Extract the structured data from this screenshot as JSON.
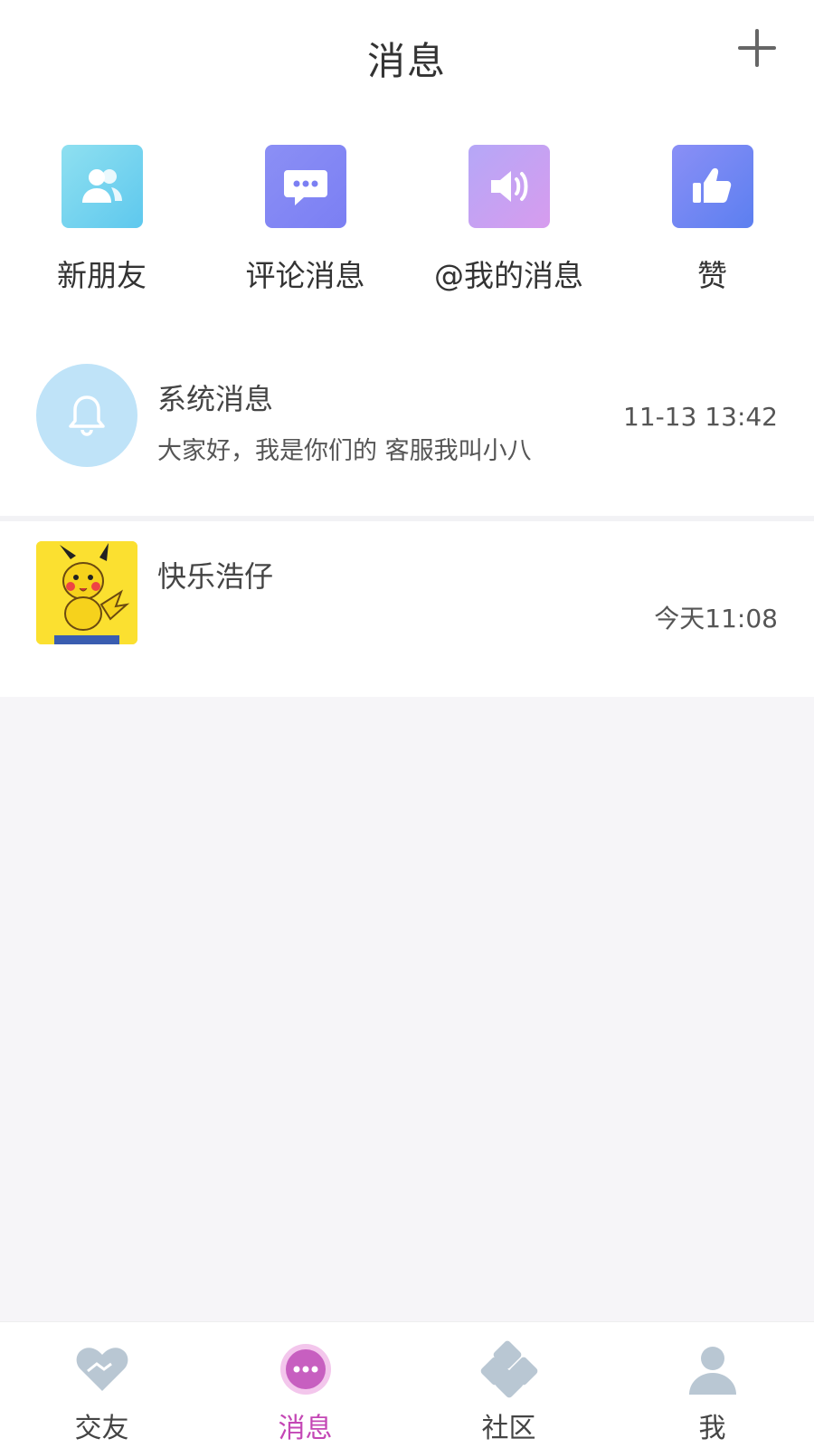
{
  "header": {
    "title": "消息",
    "add_icon": "plus-icon"
  },
  "quick_actions": [
    {
      "label": "新朋友",
      "icon": "friends-icon",
      "color": "#5ec8ee"
    },
    {
      "label": "评论消息",
      "icon": "comment-bubble-icon",
      "color": "#7b7ff3"
    },
    {
      "label": "@我的消息",
      "icon": "speaker-icon",
      "color": "#d79cee"
    },
    {
      "label": "赞",
      "icon": "thumbs-up-icon",
      "color": "#5c7ff0"
    }
  ],
  "conversations": [
    {
      "name": "系统消息",
      "preview": "大家好，我是你们的 客服我叫小八",
      "time": "11-13 13:42",
      "avatar": "bell-icon"
    },
    {
      "name": "快乐浩仔",
      "preview": "",
      "time": "今天11:08",
      "avatar": "pikachu-avatar"
    }
  ],
  "tabbar": {
    "items": [
      {
        "label": "交友",
        "icon": "handshake-heart-icon",
        "active": false
      },
      {
        "label": "消息",
        "icon": "chat-dots-icon",
        "active": true
      },
      {
        "label": "社区",
        "icon": "community-icon",
        "active": false
      },
      {
        "label": "我",
        "icon": "person-icon",
        "active": false
      }
    ],
    "active_color": "#c447b5",
    "inactive_color": "#b9c7d3"
  }
}
